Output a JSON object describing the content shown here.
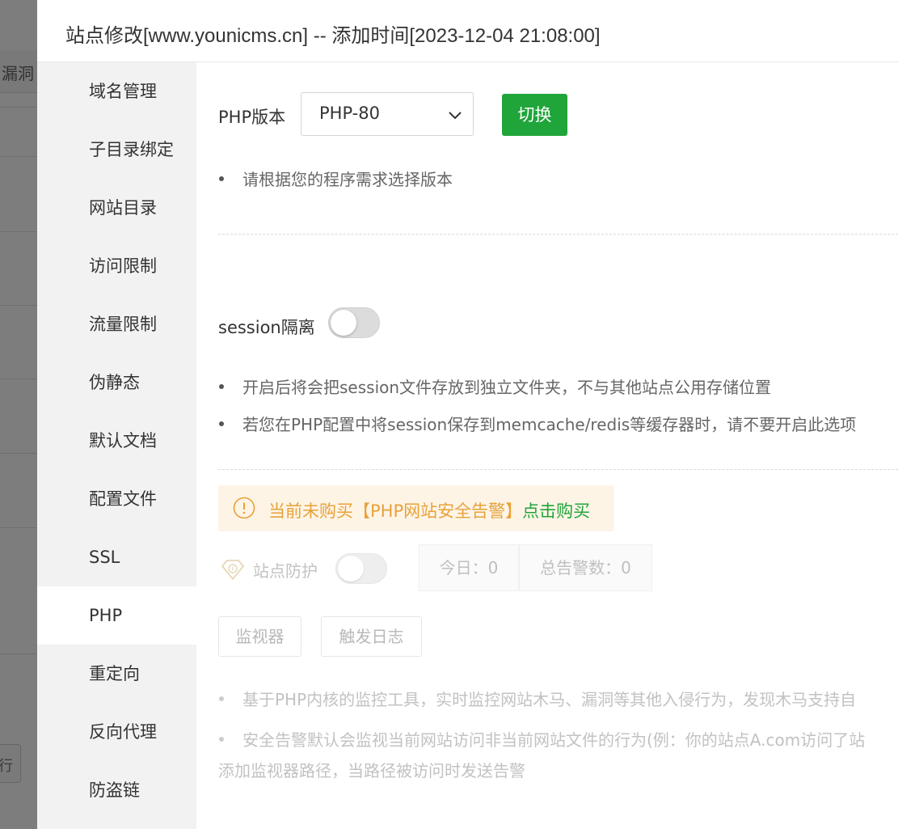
{
  "background": {
    "column_header": "漏洞",
    "button_text": "行"
  },
  "modal": {
    "title": "站点修改[www.younicms.cn] -- 添加时间[2023-12-04 21:08:00]"
  },
  "sidebar": {
    "items": [
      {
        "label": "域名管理"
      },
      {
        "label": "子目录绑定"
      },
      {
        "label": "网站目录"
      },
      {
        "label": "访问限制"
      },
      {
        "label": "流量限制"
      },
      {
        "label": "伪静态"
      },
      {
        "label": "默认文档"
      },
      {
        "label": "配置文件"
      },
      {
        "label": "SSL"
      },
      {
        "label": "PHP"
      },
      {
        "label": "重定向"
      },
      {
        "label": "反向代理"
      },
      {
        "label": "防盗链"
      }
    ],
    "active": "PHP"
  },
  "php": {
    "version_label": "PHP版本",
    "selected_version": "PHP-80",
    "switch_button": "切换",
    "tip": "请根据您的程序需求选择版本"
  },
  "session": {
    "label": "session隔离",
    "enabled": false,
    "notes": [
      "开启后将会把session文件存放到独立文件夹，不与其他站点公用存储位置",
      "若您在PHP配置中将session保存到memcache/redis等缓存器时，请不要开启此选项"
    ]
  },
  "security": {
    "warning_text": "当前未购买【PHP网站安全告警】",
    "warning_link": "点击购买",
    "protect_label": "站点防护",
    "protect_enabled": false,
    "today_label": "今日：0",
    "total_label": "总告警数：0",
    "monitor_button": "监视器",
    "log_button": "触发日志",
    "notes": [
      "基于PHP内核的监控工具，实时监控网站木马、漏洞等其他入侵行为，发现木马支持自",
      "安全告警默认会监视当前网站访问非当前网站文件的行为(例：你的站点A.com访问了站"
    ],
    "extra_note": "添加监视器路径，当路径被访问时发送告警"
  },
  "colors": {
    "accent": "#20a53a",
    "warning": "#e8a23a"
  }
}
